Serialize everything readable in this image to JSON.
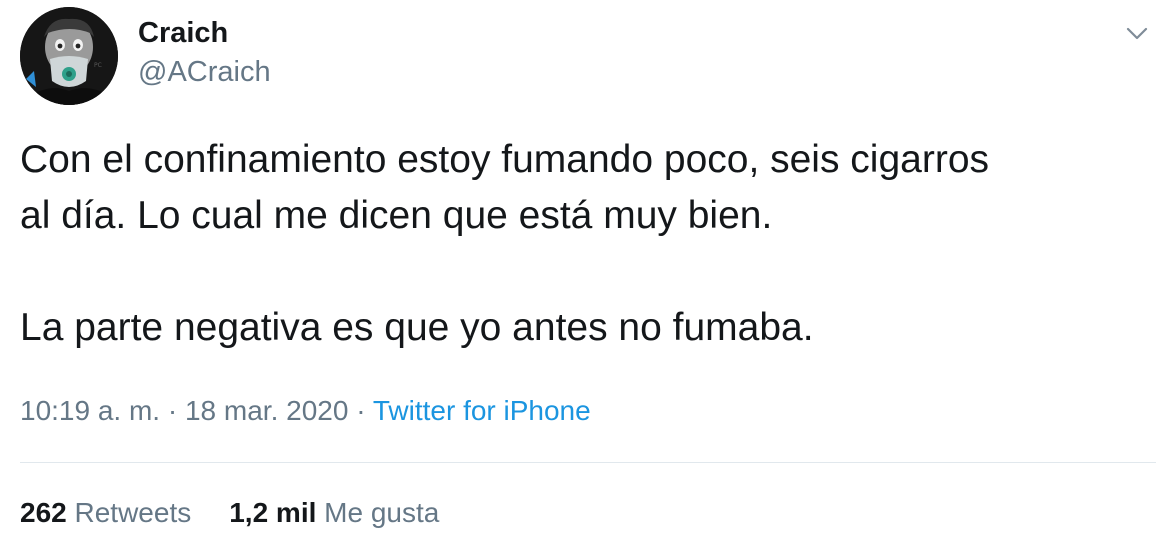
{
  "author": {
    "display_name": "Craich",
    "handle": "@ACraich",
    "avatar_icon": "profile-photo-masked-face"
  },
  "tweet": {
    "lines": [
      "Con el confinamiento estoy fumando poco, seis cigarros",
      "al día. Lo cual me dicen que está muy bien.",
      "La parte negativa es que yo antes no fumaba."
    ]
  },
  "meta": {
    "time": "10:19 a. m.",
    "separator": "·",
    "date": "18 mar. 2020",
    "source": "Twitter for iPhone"
  },
  "stats": {
    "retweets_count": "262",
    "retweets_label": "Retweets",
    "likes_count": "1,2 mil",
    "likes_label": "Me gusta"
  },
  "icons": {
    "menu": "chevron-down-icon"
  },
  "colors": {
    "text": "#14171a",
    "secondary": "#657786",
    "link": "#1b95e0",
    "divider": "#e1e8ed"
  }
}
